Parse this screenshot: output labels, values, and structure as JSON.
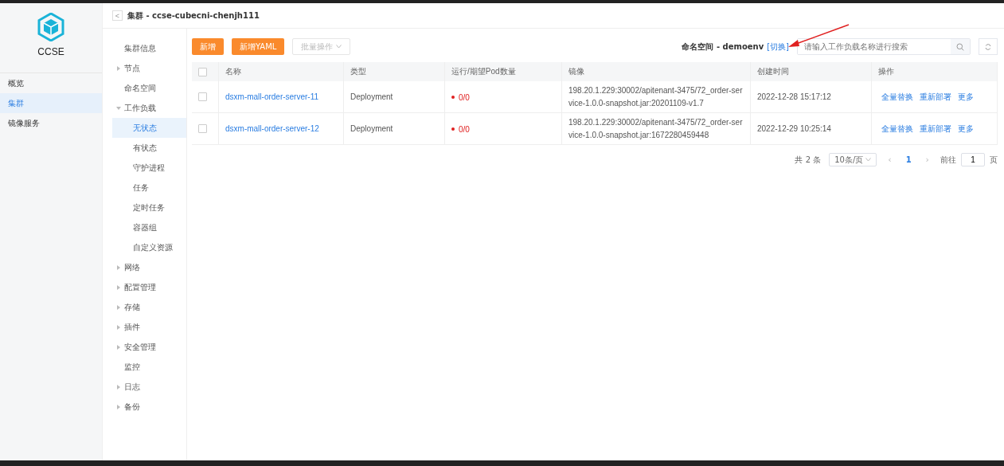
{
  "app": {
    "name": "CCSE"
  },
  "sidebar": {
    "items": [
      {
        "label": "概览",
        "selected": false
      },
      {
        "label": "集群",
        "selected": true
      },
      {
        "label": "镜像服务",
        "selected": false
      }
    ]
  },
  "header": {
    "back": "<",
    "title": "集群 - ccse-cubecni-chenjh111"
  },
  "nav": {
    "items": [
      {
        "label": "集群信息",
        "kind": "leaf",
        "selected": false
      },
      {
        "label": "节点",
        "kind": "group",
        "expanded": false,
        "selected": false
      },
      {
        "label": "命名空间",
        "kind": "leaf",
        "selected": false
      },
      {
        "label": "工作负载",
        "kind": "group",
        "expanded": true,
        "selected": false,
        "children": [
          {
            "label": "无状态",
            "selected": true
          },
          {
            "label": "有状态",
            "selected": false
          },
          {
            "label": "守护进程",
            "selected": false
          },
          {
            "label": "任务",
            "selected": false
          },
          {
            "label": "定时任务",
            "selected": false
          },
          {
            "label": "容器组",
            "selected": false
          },
          {
            "label": "自定义资源",
            "selected": false
          }
        ]
      },
      {
        "label": "网络",
        "kind": "group",
        "expanded": false,
        "selected": false
      },
      {
        "label": "配置管理",
        "kind": "group",
        "expanded": false,
        "selected": false
      },
      {
        "label": "存储",
        "kind": "group",
        "expanded": false,
        "selected": false
      },
      {
        "label": "插件",
        "kind": "group",
        "expanded": false,
        "selected": false
      },
      {
        "label": "安全管理",
        "kind": "group",
        "expanded": false,
        "selected": false
      },
      {
        "label": "监控",
        "kind": "leaf",
        "selected": false
      },
      {
        "label": "日志",
        "kind": "group",
        "expanded": false,
        "selected": false
      },
      {
        "label": "备份",
        "kind": "group",
        "expanded": false,
        "selected": false
      }
    ]
  },
  "toolbar": {
    "buttons": [
      {
        "label": "新增",
        "disabled": false
      },
      {
        "label": "新增YAML",
        "disabled": false
      },
      {
        "label": "批量操作",
        "disabled": true
      }
    ],
    "namespace_label": "命名空间 - demoenv",
    "switch_link": "[切换]",
    "search": {
      "placeholder": "请输入工作负载名称进行搜索"
    }
  },
  "table": {
    "columns": [
      "名称",
      "类型",
      "运行/期望Pod数量",
      "镜像",
      "创建时间",
      "操作"
    ],
    "header_checked": false,
    "rows": [
      {
        "checked": false,
        "name": "dsxm-mall-order-server-11",
        "type": "Deployment",
        "pods": "0/0",
        "image": "198.20.1.229:30002/apitenant-3475/72_order-service-1.0.0-snapshot.jar:20201109-v1.7",
        "created": "2022-12-28 15:17:12",
        "actions": [
          "全量替换",
          "重新部署",
          "更多"
        ]
      },
      {
        "checked": false,
        "name": "dsxm-mall-order-server-12",
        "type": "Deployment",
        "pods": "0/0",
        "image": "198.20.1.229:30002/apitenant-3475/72_order-service-1.0.0-snapshot.jar:1672280459448",
        "created": "2022-12-29 10:25:14",
        "actions": [
          "全量替换",
          "重新部署",
          "更多"
        ]
      }
    ]
  },
  "pagination": {
    "total": "共 2 条",
    "page_size": "10条/页",
    "prev": "‹",
    "pages": [
      {
        "label": "1",
        "selected": true
      }
    ],
    "next": "›",
    "goto_label": "前往",
    "goto_value": "1",
    "goto_suffix": "页"
  }
}
